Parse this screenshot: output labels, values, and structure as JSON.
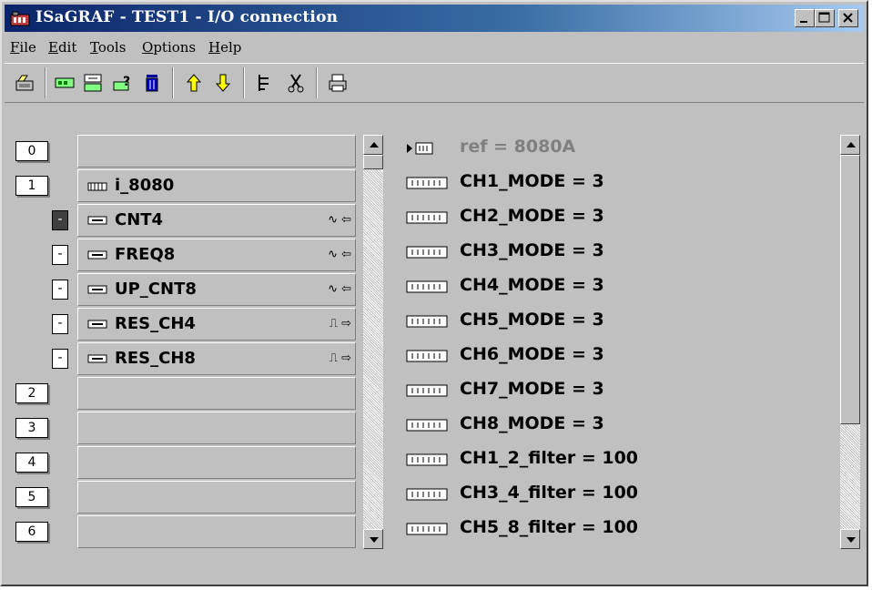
{
  "window": {
    "title": "ISaGRAF - TEST1 - I/O connection",
    "controls": [
      "minimize",
      "maximize",
      "close"
    ]
  },
  "menu": [
    {
      "label": "File",
      "accel": "F",
      "rest": "ile"
    },
    {
      "label": "Edit",
      "accel": "E",
      "rest": "dit"
    },
    {
      "label": "Tools",
      "accel": "T",
      "rest": "ools"
    },
    {
      "label": "Options",
      "accel": "O",
      "rest": "ptions"
    },
    {
      "label": "Help",
      "accel": "H",
      "rest": "elp"
    }
  ],
  "toolbar": [
    "open-icon",
    "board-icon",
    "board-edit-icon",
    "board-help-icon",
    "delete-icon",
    "move-up-icon",
    "move-down-icon",
    "tree-icon",
    "cut-icon",
    "print-icon"
  ],
  "slots": [
    {
      "num": "0",
      "label": ""
    },
    {
      "num": "1",
      "label": "i_8080"
    }
  ],
  "channels": [
    {
      "marker": "-",
      "label": "CNT4",
      "symbol": "∿ ⇦",
      "active": true
    },
    {
      "marker": "-",
      "label": "FREQ8",
      "symbol": "∿ ⇦",
      "active": false
    },
    {
      "marker": "-",
      "label": "UP_CNT8",
      "symbol": "∿ ⇦",
      "active": false
    },
    {
      "marker": "-",
      "label": "RES_CH4",
      "symbol": "⎍ ⇨",
      "active": false
    },
    {
      "marker": "-",
      "label": "RES_CH8",
      "symbol": "⎍ ⇨",
      "active": false
    }
  ],
  "empty_slots": [
    {
      "num": "2",
      "label": ""
    },
    {
      "num": "3",
      "label": ""
    },
    {
      "num": "4",
      "label": ""
    },
    {
      "num": "5",
      "label": ""
    },
    {
      "num": "6",
      "label": ""
    }
  ],
  "parameters": {
    "reference": "ref = 8080A",
    "items": [
      "CH1_MODE = 3",
      "CH2_MODE = 3",
      "CH3_MODE = 3",
      "CH4_MODE = 3",
      "CH5_MODE = 3",
      "CH6_MODE = 3",
      "CH7_MODE = 3",
      "CH8_MODE = 3",
      "CH1_2_filter = 100",
      "CH3_4_filter = 100",
      "CH5_8_filter = 100"
    ]
  },
  "colors": {
    "titlebar_start": "#0a246a",
    "titlebar_end": "#a6caf0",
    "face": "#c0c0c0",
    "reference_text": "#808080"
  }
}
